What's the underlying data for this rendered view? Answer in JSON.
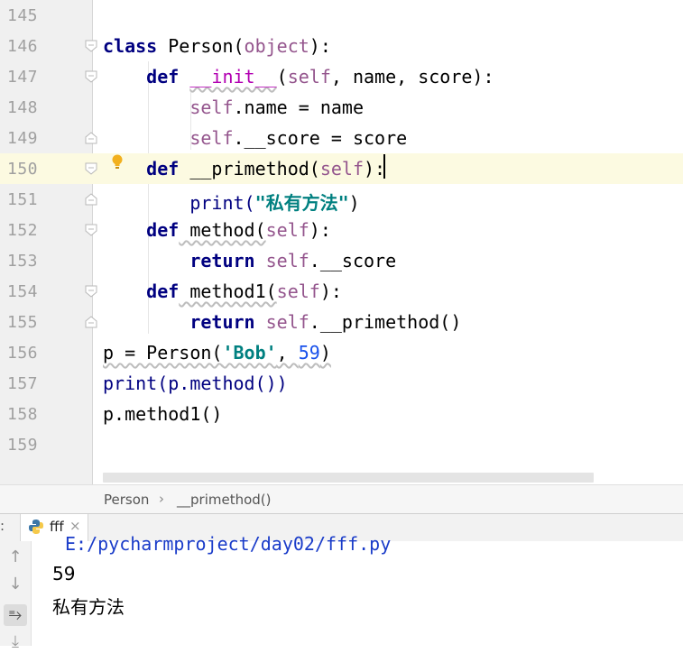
{
  "editor": {
    "lines": [
      {
        "num": "145"
      },
      {
        "num": "146"
      },
      {
        "num": "147"
      },
      {
        "num": "148"
      },
      {
        "num": "149"
      },
      {
        "num": "150"
      },
      {
        "num": "151"
      },
      {
        "num": "152"
      },
      {
        "num": "153"
      },
      {
        "num": "154"
      },
      {
        "num": "155"
      },
      {
        "num": "156"
      },
      {
        "num": "157"
      },
      {
        "num": "158"
      },
      {
        "num": "159"
      }
    ],
    "code": {
      "l146": {
        "kw": "class",
        "name": " Person(",
        "base": "object",
        "end": "):"
      },
      "l147": {
        "kw": "def",
        "fn": "__init__",
        "open": "(",
        "self": "self",
        "rest": ", name, score):"
      },
      "l148": {
        "self": "self",
        "rest": ".name = name"
      },
      "l149": {
        "self": "self",
        "rest": ".__score = score"
      },
      "l150": {
        "kw": "def",
        "fn": " __primethod(",
        "self": "self",
        "end": "):"
      },
      "l151": {
        "fn": "print(",
        "str": "\"私有方法\"",
        "end": ")"
      },
      "l152": {
        "kw": "def",
        "fn": " method(",
        "self": "self",
        "end": "):"
      },
      "l153": {
        "kw": "return",
        "self": " self",
        "rest": ".__score"
      },
      "l154": {
        "kw": "def",
        "fn": " method1(",
        "self": "self",
        "end": "):"
      },
      "l155": {
        "kw": "return",
        "self": " self",
        "rest": ".__primethod()"
      },
      "l156": {
        "pre": "p = Person(",
        "str": "'Bob'",
        "mid": ", ",
        "num": "59",
        "end": ")"
      },
      "l157": {
        "text": "print(p.method())"
      },
      "l158": {
        "text": "p.method1()"
      }
    }
  },
  "breadcrumb": {
    "class": "Person",
    "separator": "›",
    "method": "__primethod()"
  },
  "run_panel": {
    "colon": ":",
    "tab_label": "fff",
    "close": "×",
    "icons": [
      "arrow-up-icon",
      "arrow-down-icon",
      "soft-wrap-icon",
      "scroll-to-end-icon"
    ],
    "output": {
      "path": "E:/pycharmproject/day02/fff.py",
      "line1": "59",
      "line2": "私有方法"
    }
  },
  "colors": {
    "keyword": "#000080",
    "self": "#94558d",
    "string": "#008080",
    "number": "#1750eb",
    "current_line": "#fcfae1"
  }
}
